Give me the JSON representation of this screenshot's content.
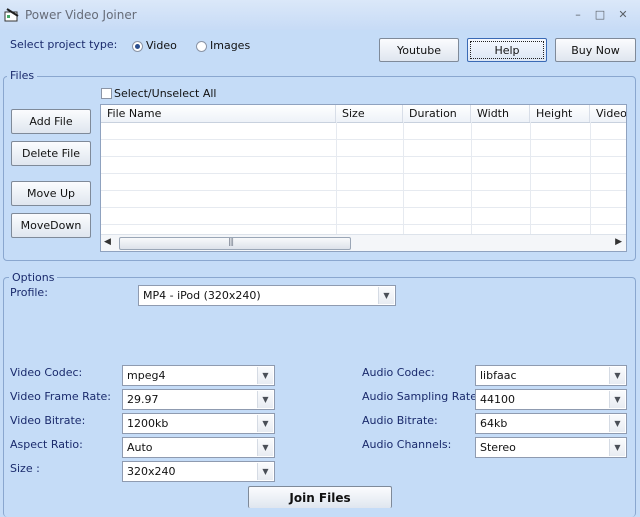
{
  "window": {
    "title": "Power Video Joiner",
    "minimize_glyph": "–",
    "maximize_glyph": "□",
    "close_glyph": "✕"
  },
  "project": {
    "label": "Select project type:",
    "options": [
      {
        "label": "Video",
        "selected": true
      },
      {
        "label": "Images",
        "selected": false
      }
    ]
  },
  "top_buttons": {
    "youtube": "Youtube",
    "help": "Help",
    "buy_now": "Buy Now"
  },
  "files": {
    "legend": "Files",
    "select_all_label": "Select/Unselect All",
    "buttons": {
      "add": "Add File",
      "delete": "Delete File",
      "move_up": "Move Up",
      "move_down": "MoveDown"
    },
    "columns": [
      "File Name",
      "Size",
      "Duration",
      "Width",
      "Height",
      "Video"
    ],
    "rows": [],
    "scroll_grip": "|||",
    "scroll_left": "◀",
    "scroll_right": "▶"
  },
  "options": {
    "legend": "Options",
    "profile_label": "Profile:",
    "profile_value": "MP4 - iPod (320x240)",
    "video": {
      "codec_label": "Video Codec:",
      "codec": "mpeg4",
      "frame_rate_label": "Video Frame Rate:",
      "frame_rate": "29.97",
      "bitrate_label": "Video Bitrate:",
      "bitrate": "1200kb",
      "aspect_label": "Aspect Ratio:",
      "aspect": "Auto",
      "size_label": "Size :",
      "size": "320x240"
    },
    "audio": {
      "codec_label": "Audio Codec:",
      "codec": "libfaac",
      "sampling_label": "Audio Sampling Rate:",
      "sampling": "44100",
      "bitrate_label": "Audio Bitrate:",
      "bitrate": "64kb",
      "channels_label": "Audio Channels:",
      "channels": "Stereo"
    },
    "arrow_glyph": "▼"
  },
  "join_button": "Join Files"
}
